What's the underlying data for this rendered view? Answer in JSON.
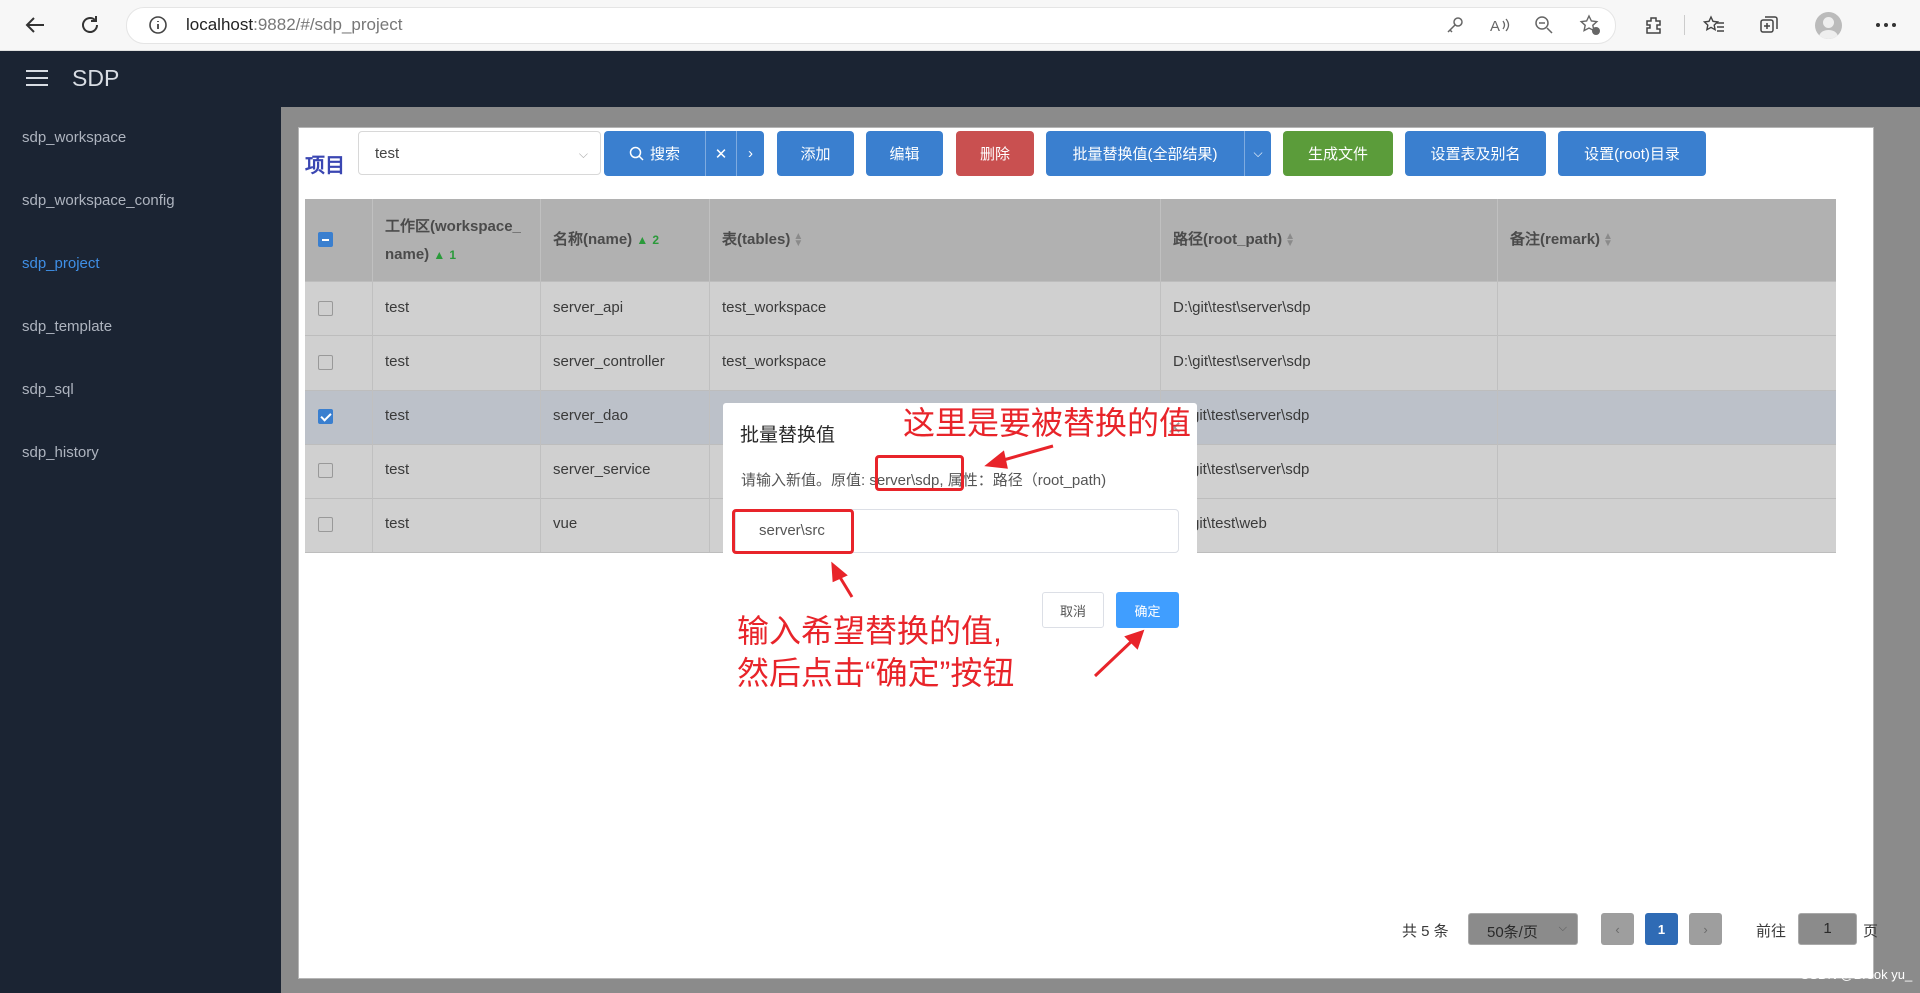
{
  "browser": {
    "url_host": "localhost",
    "url_rest": ":9882/#/sdp_project"
  },
  "app": {
    "title": "SDP"
  },
  "sidebar": {
    "items": [
      {
        "label": "sdp_workspace",
        "active": false
      },
      {
        "label": "sdp_workspace_config",
        "active": false
      },
      {
        "label": "sdp_project",
        "active": true
      },
      {
        "label": "sdp_template",
        "active": false
      },
      {
        "label": "sdp_sql",
        "active": false
      },
      {
        "label": "sdp_history",
        "active": false
      }
    ]
  },
  "toolbar": {
    "page_title": "项目",
    "workspace_select": "test",
    "search_label": "搜索",
    "add_label": "添加",
    "edit_label": "编辑",
    "delete_label": "删除",
    "batch_replace_label": "批量替换值(全部结果)",
    "generate_label": "生成文件",
    "alias_label": "设置表及别名",
    "root_dir_label": "设置(root)目录"
  },
  "table": {
    "headers": {
      "workspace_line1": "工作区(workspace_",
      "workspace_line2": "name)",
      "workspace_sort_order": "1",
      "name": "名称(name)",
      "name_sort_order": "2",
      "tables": "表(tables)",
      "root_path": "路径(root_path)",
      "remark": "备注(remark)"
    },
    "rows": [
      {
        "workspace": "test",
        "name": "server_api",
        "tables": "test_workspace",
        "root_path": "D:\\git\\test\\server\\sdp",
        "remark": "",
        "checked": false
      },
      {
        "workspace": "test",
        "name": "server_controller",
        "tables": "test_workspace",
        "root_path": "D:\\git\\test\\server\\sdp",
        "remark": "",
        "checked": false
      },
      {
        "workspace": "test",
        "name": "server_dao",
        "tables": "",
        "root_path": "git\\test\\server\\sdp",
        "remark": "",
        "checked": true
      },
      {
        "workspace": "test",
        "name": "server_service",
        "tables": "",
        "root_path": "git\\test\\server\\sdp",
        "remark": "",
        "checked": false
      },
      {
        "workspace": "test",
        "name": "vue",
        "tables": "",
        "root_path": "git\\test\\web",
        "remark": "",
        "checked": false
      }
    ]
  },
  "pagination": {
    "total": "共 5 条",
    "page_size": "50条/页",
    "current_page": "1",
    "goto_label": "前往",
    "goto_value": "1",
    "page_unit": "页"
  },
  "dialog": {
    "title": "批量替换值",
    "message_prefix": "请输入新值。原值:",
    "old_value": "server\\sdp,",
    "message_suffix": "属性：路径（root_path)",
    "input_value": "server\\src",
    "cancel_label": "取消",
    "ok_label": "确定"
  },
  "annotations": {
    "top": "这里是要被替换的值",
    "bottom_line1": "输入希望替换的值,",
    "bottom_line2": "然后点击“确定”按钮"
  },
  "watermark": "CSDN @Brook yu_",
  "colors": {
    "header_bg": "#1b2433",
    "accent_blue": "#3a7fcf",
    "danger": "#c95050",
    "success": "#5b9c3a",
    "annotation_red": "#e8242a",
    "dialog_ok": "#409eff"
  }
}
